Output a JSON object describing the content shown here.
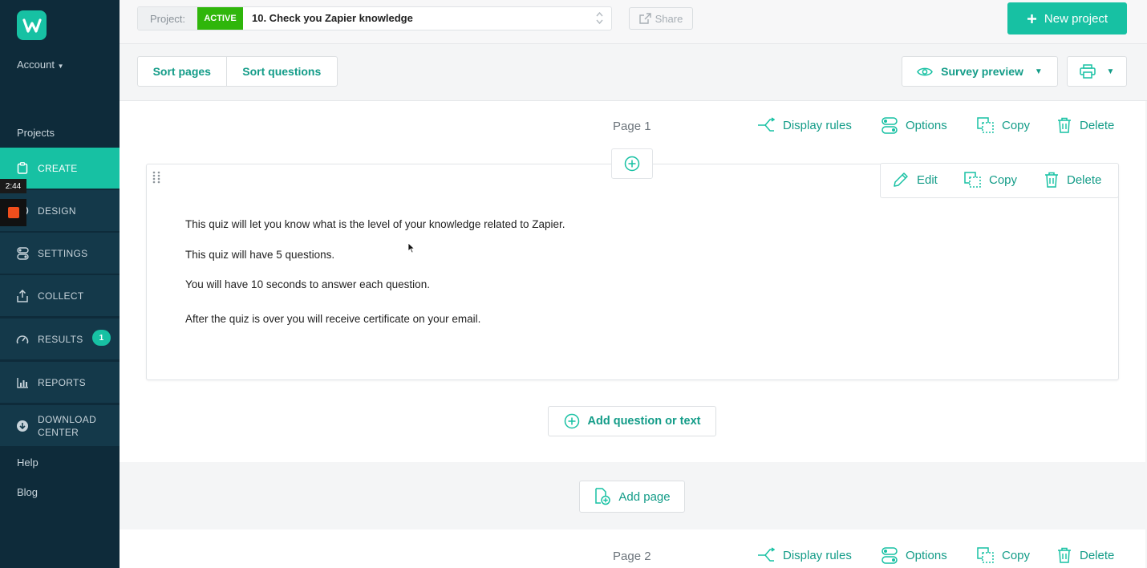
{
  "sidebar": {
    "account": "Account",
    "projects": "Projects",
    "nav": [
      {
        "label": "CREATE",
        "icon": "clipboard-icon",
        "active": true
      },
      {
        "label": "DESIGN",
        "icon": "palette-icon"
      },
      {
        "label": "SETTINGS",
        "icon": "toggles-icon"
      },
      {
        "label": "COLLECT",
        "icon": "upload-icon"
      },
      {
        "label": "RESULTS",
        "icon": "gauge-icon",
        "badge": "1"
      },
      {
        "label": "REPORTS",
        "icon": "bar-chart-icon"
      },
      {
        "label": "DOWNLOAD",
        "label2": "CENTER",
        "icon": "download-icon"
      }
    ],
    "help": "Help",
    "blog": "Blog",
    "recorder_time": "2:44"
  },
  "topbar": {
    "project_label": "Project:",
    "status": "ACTIVE",
    "project_name": "10. Check you Zapier knowledge",
    "share": "Share",
    "new_project": "New project"
  },
  "toolbar": {
    "sort_pages": "Sort pages",
    "sort_questions": "Sort questions",
    "survey_preview": "Survey preview"
  },
  "page1": {
    "title": "Page 1",
    "display_rules": "Display rules",
    "options": "Options",
    "copy": "Copy",
    "delete": "Delete"
  },
  "question": {
    "edit": "Edit",
    "copy": "Copy",
    "delete": "Delete",
    "lines": [
      "This quiz will let you know what is the level of your knowledge related to Zapier.",
      "This quiz will have 5 questions.",
      "You will have 10 seconds to answer each question.",
      "After the quiz is over you will receive certificate on your email."
    ]
  },
  "add_question": "Add question or text",
  "add_page": "Add page",
  "page2": {
    "title": "Page 2",
    "display_rules": "Display rules",
    "options": "Options",
    "copy": "Copy",
    "delete": "Delete"
  },
  "colors": {
    "accent": "#17c1a3",
    "accent_text": "#139c88",
    "sidebar": "#0e2b3a",
    "active_status": "#2fb60b"
  }
}
